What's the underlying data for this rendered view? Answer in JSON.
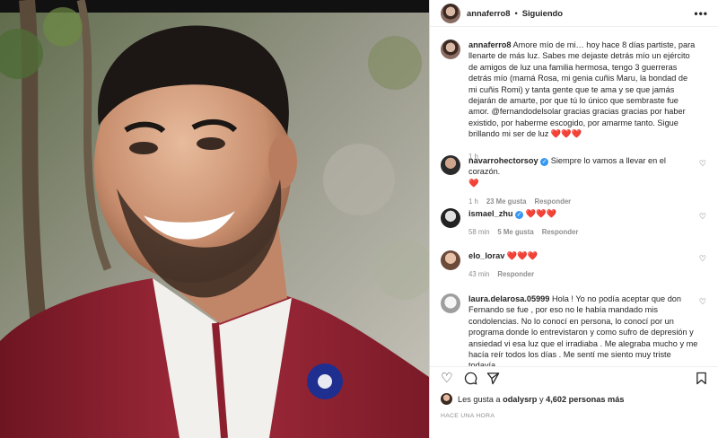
{
  "post": {
    "author": "annaferro8",
    "separator": "•",
    "follow_label": "Siguiendo",
    "caption": "Amore mío de mi… hoy hace 8 días partiste, para llenarte de más luz. Sabes me dejaste detrás mío un ejército de amigos de luz una familia hermosa, tengo 3 guerreras detrás mío (mamá Rosa, mi genia cuñis Maru, la bondad de mi cuñis Romi) y tanta gente que te ama y se que jamás dejarán de amarte, por que tú lo único que sembraste fue amor. @fernandodelsolar gracias gracias gracias por haber existido, por haberme escogido, por amarme tanto. Sigue brillando mi ser de luz ❤️❤️❤️",
    "caption_time": "1 h",
    "likes_prefix": "Les gusta a",
    "likes_user": "odalysrp",
    "likes_mid": "y",
    "likes_count": "4,602 personas más",
    "timestamp": "HACE UNA HORA"
  },
  "comments": [
    {
      "user": "navarrohectorsoy",
      "verified": true,
      "text": "Siempre lo vamos a llevar en el corazón.",
      "hearts": "❤️",
      "time": "1 h",
      "likes": "23 Me gusta",
      "reply": "Responder"
    },
    {
      "user": "ismael_zhu",
      "verified": true,
      "text": "",
      "hearts": "❤️❤️❤️",
      "time": "58 min",
      "likes": "5 Me gusta",
      "reply": "Responder"
    },
    {
      "user": "elo_lorav",
      "verified": false,
      "text": "",
      "hearts": "❤️❤️❤️",
      "time": "43 min",
      "likes": "",
      "reply": "Responder"
    },
    {
      "user": "laura.delarosa.05999",
      "verified": false,
      "text": "Hola ! Yo no podía aceptar que don Fernando se fue , por eso no le había mandado mis condolencias. No lo conocí en persona, lo conocí por un programa donde lo entrevistaron y como sufro de depresión y ansiedad vi esa luz que el irradiaba . Me alegraba mucho y me hacía reír todos los días . Me sentí me siento muy triste todavía",
      "hearts": "",
      "time": "",
      "likes": "",
      "reply": ""
    }
  ],
  "icons": {
    "more": "more-options-icon",
    "like": "heart-icon",
    "comment": "comment-icon",
    "share": "share-icon",
    "save": "bookmark-icon",
    "verified": "verified-badge-icon"
  },
  "colors": {
    "heart_red": "#ed4956",
    "verified_blue": "#3897f0",
    "muted": "#8e8e8e",
    "jacket": "#8c1f2e"
  }
}
